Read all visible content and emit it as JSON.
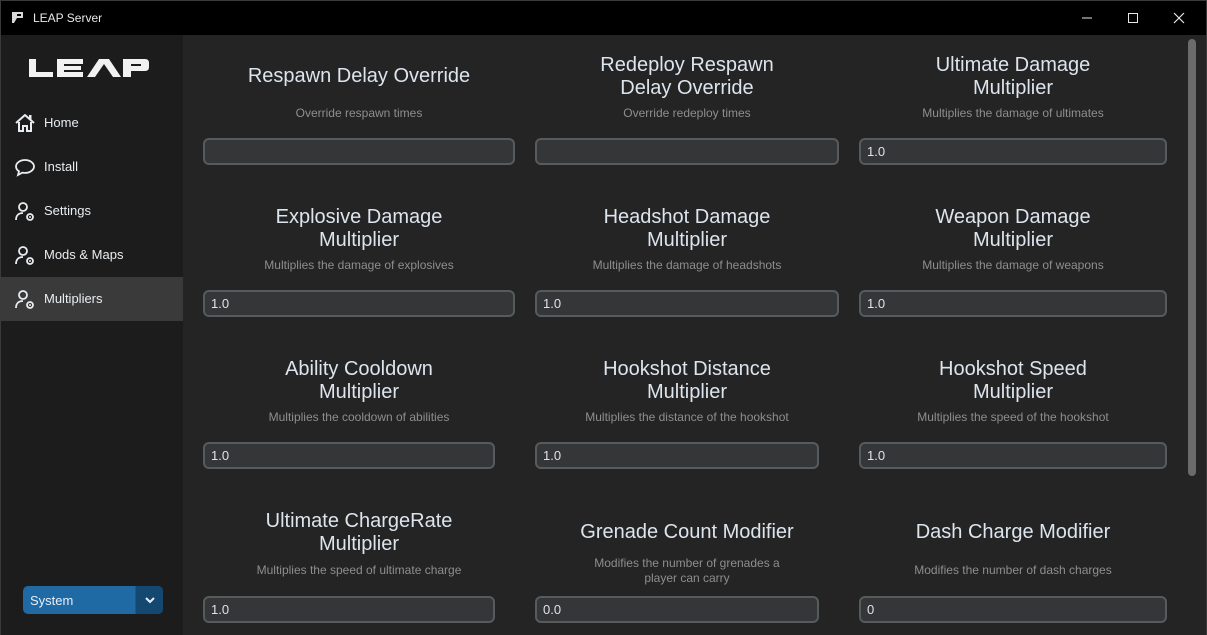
{
  "window": {
    "title": "LEAP Server"
  },
  "sidebar": {
    "logo_text": "LEAP",
    "items": [
      {
        "label": "Home",
        "icon": "home-icon"
      },
      {
        "label": "Install",
        "icon": "chat-icon"
      },
      {
        "label": "Settings",
        "icon": "user-gear-icon"
      },
      {
        "label": "Mods & Maps",
        "icon": "user-gear-icon"
      },
      {
        "label": "Multipliers",
        "icon": "user-gear-icon",
        "active": true
      }
    ],
    "theme_select": {
      "value": "System"
    }
  },
  "fields": [
    {
      "title": "Respawn Delay Override",
      "description": "Override respawn times",
      "value": ""
    },
    {
      "title": "Redeploy Respawn\nDelay Override",
      "description": "Override redeploy times",
      "value": ""
    },
    {
      "title": "Ultimate Damage\nMultiplier",
      "description": "Multiplies the damage of ultimates",
      "value": "1.0"
    },
    {
      "title": "Explosive Damage\nMultiplier",
      "description": "Multiplies the damage of explosives",
      "value": "1.0"
    },
    {
      "title": "Headshot Damage\nMultiplier",
      "description": "Multiplies the damage of headshots",
      "value": "1.0"
    },
    {
      "title": "Weapon Damage\nMultiplier",
      "description": "Multiplies the damage of weapons",
      "value": "1.0"
    },
    {
      "title": "Ability Cooldown\nMultiplier",
      "description": "Multiplies the cooldown of abilities",
      "value": "1.0"
    },
    {
      "title": "Hookshot Distance\nMultiplier",
      "description": "Multiplies the distance of the hookshot",
      "value": "1.0"
    },
    {
      "title": "Hookshot Speed\nMultiplier",
      "description": "Multiplies the speed of the hookshot",
      "value": "1.0"
    },
    {
      "title": "Ultimate ChargeRate\nMultiplier",
      "description": "Multiplies the speed of ultimate charge",
      "value": "1.0"
    },
    {
      "title": "Grenade Count Modifier",
      "description": "Modifies the number of grenades a\nplayer can carry",
      "value": "0.0"
    },
    {
      "title": "Dash Charge Modifier",
      "description": "Modifies the number of dash charges",
      "value": "0"
    }
  ],
  "colors": {
    "accent": "#1f6aa5",
    "background": "#242424",
    "sidebar": "#1c1c1c",
    "input_bg": "#343638",
    "input_border": "#565b5e"
  }
}
